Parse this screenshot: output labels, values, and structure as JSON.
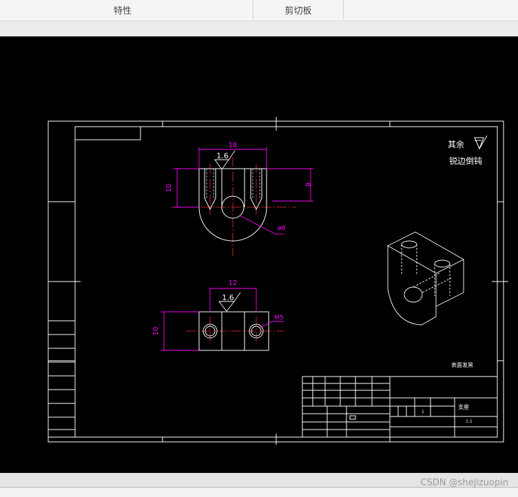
{
  "ribbon": {
    "groups": [
      {
        "label": "特性"
      },
      {
        "label": "剪切板"
      }
    ]
  },
  "drawing": {
    "note_other": "其余",
    "note_edges": "锐边倒钝",
    "front_view": {
      "dim_width": "18",
      "dim_height_left": "10",
      "dim_height_right": "8",
      "roughness": "1.6",
      "dim_hole": "ø8"
    },
    "top_view": {
      "dim_width": "12",
      "dim_height": "10",
      "roughness": "1.6",
      "thread": "M5"
    },
    "tech_req": "表面发黑",
    "title_block": {
      "part_name": "支座",
      "scale": "1:1",
      "sheet": "1"
    }
  },
  "watermark": "CSDN @shejizuopin",
  "colors": {
    "background": "#000000",
    "lines": "#ffffff",
    "dimensions": "#ff00ff",
    "center": "#ff0000"
  }
}
